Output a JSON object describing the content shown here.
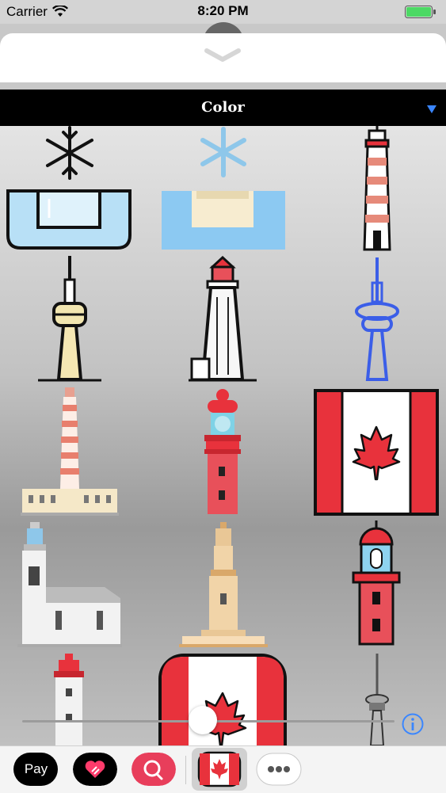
{
  "status_bar": {
    "carrier": "Carrier",
    "time": "8:20 PM"
  },
  "category_picker": {
    "selected": "Color"
  },
  "app_drawer": {
    "apple_pay_label": "Pay"
  },
  "stickers": [
    "snowflake-box-outline",
    "snowflake-box-flat",
    "lighthouse-tall-striped",
    "cn-tower-outline",
    "lighthouse-outline",
    "cn-tower-blue",
    "lighthouse-striped-building",
    "lighthouse-red",
    "canada-flag",
    "lighthouse-white-house",
    "tower-tan",
    "lighthouse-red-dome",
    "lighthouse-small",
    "canada-flag-rounded",
    "cn-tower-gray"
  ],
  "colors": {
    "accent": "#3a86ff",
    "flag_red": "#e8323c"
  }
}
